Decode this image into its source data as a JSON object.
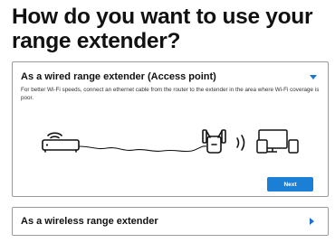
{
  "page": {
    "title": "How do you want to use your range extender?"
  },
  "options": {
    "wired": {
      "title": "As a wired range extender (Access point)",
      "description": "For better Wi-Fi speeds, connect an ethernet cable from the router to the extender in the area where Wi-Fi coverage is poor.",
      "expanded": true,
      "next_label": "Next"
    },
    "wireless": {
      "title": "As a wireless range extender",
      "expanded": false
    }
  },
  "icons": {
    "router": "router-icon",
    "cable": "ethernet-cable-icon",
    "extender": "range-extender-icon",
    "signal": "wifi-signal-icon",
    "devices": "devices-icon",
    "expand": "chevron-down-icon",
    "collapse": "chevron-right-icon"
  },
  "colors": {
    "accent": "#1b7fd6",
    "border": "#9a9a9a",
    "text": "#111111"
  }
}
